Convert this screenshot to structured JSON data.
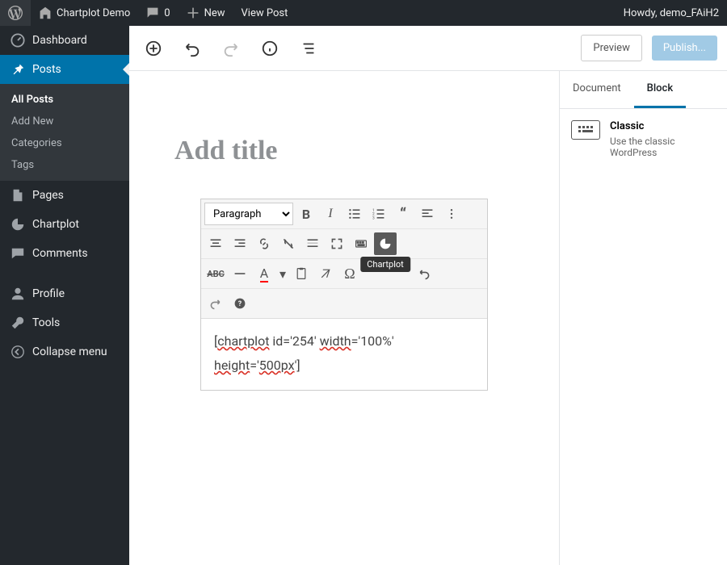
{
  "topbar": {
    "site_name": "Chartplot Demo",
    "comment_count": "0",
    "new_label": "New",
    "view_post": "View Post",
    "howdy": "Howdy, demo_FAiH2"
  },
  "sidebar": {
    "dashboard": "Dashboard",
    "posts": "Posts",
    "posts_sub": [
      "All Posts",
      "Add New",
      "Categories",
      "Tags"
    ],
    "pages": "Pages",
    "chartplot": "Chartplot",
    "comments": "Comments",
    "profile": "Profile",
    "tools": "Tools",
    "collapse": "Collapse menu"
  },
  "editor": {
    "preview": "Preview",
    "publish": "Publish...",
    "title_placeholder": "Add title",
    "format_option": "Paragraph",
    "tooltip_chartplot": "Chartplot",
    "content_prefix": "[",
    "content_w1": "chartplot",
    "content_mid1": " id='254' ",
    "content_w2": "width",
    "content_mid2": "='100%' ",
    "content_w3": "height",
    "content_mid3": "='",
    "content_w4": "500px",
    "content_suffix": "']"
  },
  "rpanel": {
    "tab_document": "Document",
    "tab_block": "Block",
    "block_title": "Classic",
    "block_desc": "Use the classic WordPress"
  }
}
